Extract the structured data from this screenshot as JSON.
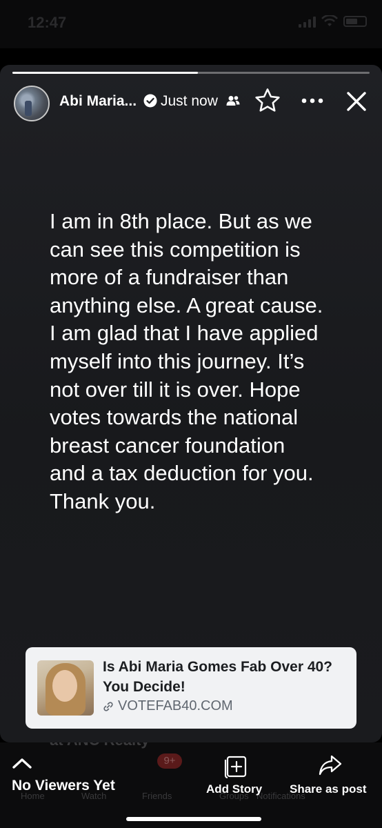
{
  "status_bar": {
    "time": "12:47"
  },
  "story": {
    "progress": 0.52,
    "author_name": "Abi Maria...",
    "timestamp": "Just now",
    "icons": {
      "verified": "verified-badge-icon",
      "audience": "friends-icon",
      "favorite": "star-icon",
      "more": "more-options-icon",
      "close": "close-icon"
    },
    "text": "I am in 8th place. But as we\ncan see this competition is\nmore of a fundraiser than\nanything else. A great cause.\nI am glad that I have applied\nmyself into this journey. It’s\nnot over till it is over. Hope\nvotes towards the national\nbreast cancer foundation\nand a tax deduction for you.\nThank you.",
    "link_card": {
      "title": "Is Abi Maria Gomes Fab Over 40? You Decide!",
      "domain": "VOTEFAB40.COM"
    }
  },
  "background": {
    "text_fragment": "at ANC Realty",
    "nav": [
      "Home",
      "Watch",
      "Friends",
      "Groups",
      "Notifications"
    ],
    "badge": "9+"
  },
  "bottom_bar": {
    "viewers_label": "No Viewers Yet",
    "add_story_label": "Add Story",
    "share_label": "Share as post"
  },
  "colors": {
    "story_bg": "#1f2024",
    "link_card_bg": "#f1f2f4",
    "link_title": "#1c1e21",
    "link_domain": "#606770"
  }
}
